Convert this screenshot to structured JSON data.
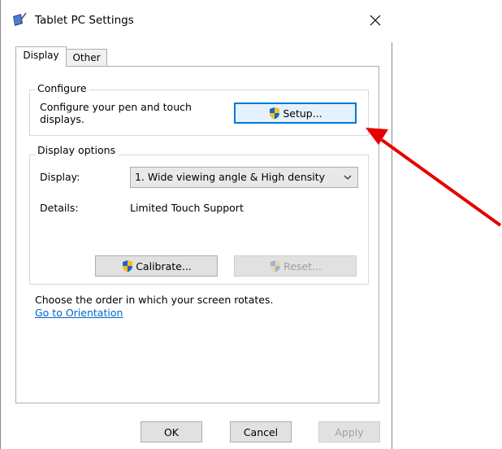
{
  "window": {
    "title": "Tablet PC Settings",
    "icon": "tablet-pen-icon"
  },
  "tabs": [
    {
      "label": "Display",
      "selected": true
    },
    {
      "label": "Other",
      "selected": false
    }
  ],
  "configure": {
    "legend": "Configure",
    "description": "Configure your pen and touch displays.",
    "setup_button": "Setup..."
  },
  "display_options": {
    "legend": "Display options",
    "display_label": "Display:",
    "display_value": "1. Wide viewing angle & High density",
    "details_label": "Details:",
    "details_value": "Limited Touch Support",
    "calibrate_button": "Calibrate...",
    "reset_button": "Reset..."
  },
  "orientation": {
    "text": "Choose the order in which your screen rotates.",
    "link": "Go to Orientation"
  },
  "footer": {
    "ok": "OK",
    "cancel": "Cancel",
    "apply": "Apply"
  },
  "colors": {
    "accent": "#0078d7",
    "link": "#0066cc",
    "annotation_arrow": "#e60000"
  }
}
